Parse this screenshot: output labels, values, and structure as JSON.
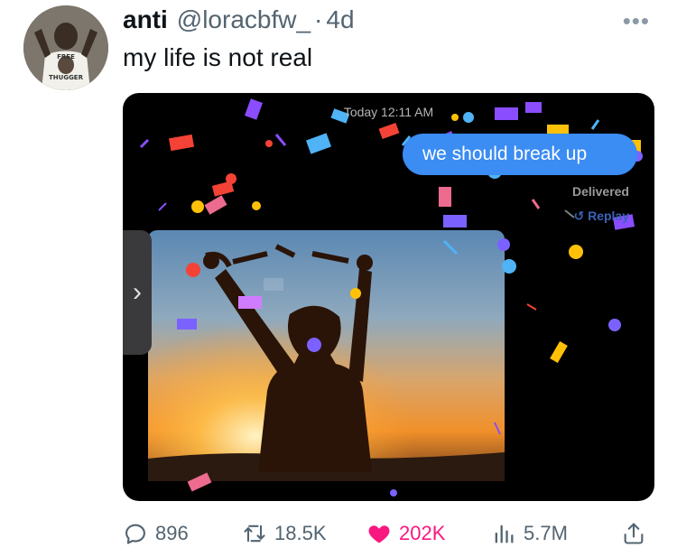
{
  "tweet": {
    "display_name": "anti",
    "handle": "@loracbfw_",
    "separator": "·",
    "time_ago": "4d",
    "more_icon": "more-dots-icon",
    "text": "my life is not real"
  },
  "avatar": {
    "shirt_text_top": "FREE",
    "shirt_text_bottom": "THUGGER"
  },
  "media": {
    "message_timestamp": "Today 12:11 AM",
    "message_text": "we should break up",
    "delivered_label": "Delivered",
    "replay_label": "↺ Replay",
    "bubble_color": "#3b8cf3",
    "nav_handle_icon": "chevron-right-icon"
  },
  "actions": {
    "replies": "896",
    "retweets": "18.5K",
    "likes": "202K",
    "views": "5.7M",
    "like_color": "#f91880",
    "icon_color": "#536471"
  }
}
